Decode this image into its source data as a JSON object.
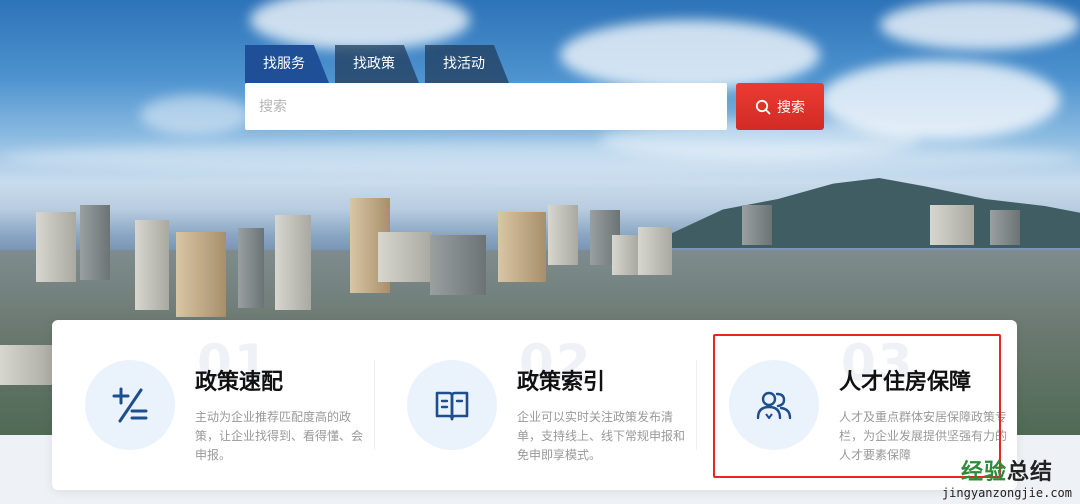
{
  "tabs": [
    {
      "label": "找服务",
      "active": true
    },
    {
      "label": "找政策",
      "active": false
    },
    {
      "label": "找活动",
      "active": false
    }
  ],
  "search": {
    "placeholder": "搜索",
    "button_label": "搜索",
    "button_icon": "search-icon"
  },
  "cards": [
    {
      "number": "01",
      "title": "政策速配",
      "description": "主动为企业推荐匹配度高的政策，让企业找得到、看得懂、会申报。",
      "icon": "plus-divide-icon"
    },
    {
      "number": "02",
      "title": "政策索引",
      "description": "企业可以实时关注政策发布清单，支持线上、线下常规申报和免申即享模式。",
      "icon": "book-icon"
    },
    {
      "number": "03",
      "title": "人才住房保障",
      "description": "人才及重点群体安居保障政策专栏，为企业发展提供坚强有力的人才要素保障",
      "icon": "users-icon"
    }
  ],
  "watermark": {
    "main_prefix": "经验",
    "main_suffix": "总结",
    "url": "jingyanzongjie.com"
  },
  "colors": {
    "tab_active": "#1e4f97",
    "search_button": "#e0332c",
    "highlight_border": "#e8261f",
    "icon_blue": "#1f4e8c"
  }
}
